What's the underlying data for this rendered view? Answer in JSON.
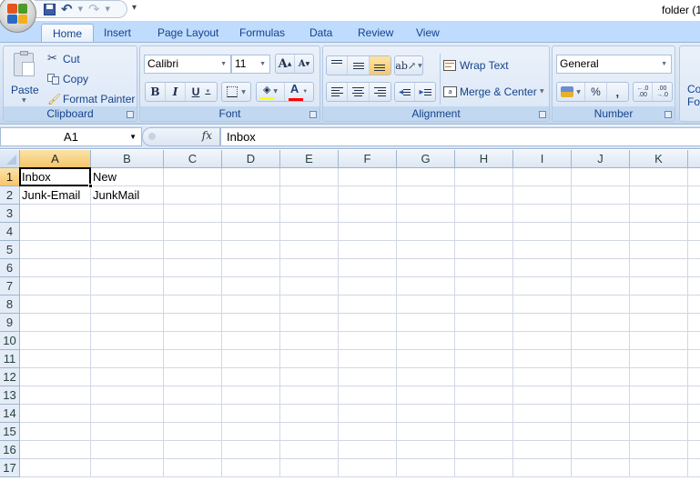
{
  "window": {
    "title": "folder (1",
    "office_button_icon": "office-logo-icon"
  },
  "quick_access": {
    "items": [
      {
        "name": "save",
        "icon": "save-icon",
        "glyph": "💾"
      },
      {
        "name": "undo",
        "icon": "undo-icon",
        "glyph": "↶"
      },
      {
        "name": "redo",
        "icon": "redo-icon",
        "glyph": "↷"
      }
    ],
    "customize_glyph": "⩡"
  },
  "tabs": [
    {
      "label": "Home",
      "active": true
    },
    {
      "label": "Insert"
    },
    {
      "label": "Page Layout"
    },
    {
      "label": "Formulas"
    },
    {
      "label": "Data"
    },
    {
      "label": "Review"
    },
    {
      "label": "View"
    }
  ],
  "ribbon": {
    "clipboard": {
      "label": "Clipboard",
      "paste": "Paste",
      "cut": "Cut",
      "copy": "Copy",
      "format_painter": "Format Painter"
    },
    "font": {
      "label": "Font",
      "font_name": "Calibri",
      "font_size": "11",
      "bold": "B",
      "italic": "I",
      "underline": "U",
      "grow": "A",
      "shrink": "A",
      "font_color": "A",
      "fill_color_hex": "#ffff00",
      "font_color_hex": "#ff0000"
    },
    "alignment": {
      "label": "Alignment",
      "wrap_text": "Wrap Text",
      "merge_center": "Merge & Center"
    },
    "number": {
      "label": "Number",
      "format": "General",
      "percent": "%",
      "comma": ",",
      "increase_decimal": ".00",
      "decrease_decimal": ".0"
    },
    "styles": {
      "conditional_line1": "Co",
      "conditional_line2": "For"
    }
  },
  "formula_bar": {
    "name_box": "A1",
    "fx": "fx",
    "value": "Inbox"
  },
  "sheet": {
    "columns": [
      "A",
      "B",
      "C",
      "D",
      "E",
      "F",
      "G",
      "H",
      "I",
      "J",
      "K"
    ],
    "rows": [
      "1",
      "2",
      "3",
      "4",
      "5",
      "6",
      "7",
      "8",
      "9",
      "10",
      "11",
      "12",
      "13",
      "14",
      "15",
      "16",
      "17"
    ],
    "cells": [
      [
        "Inbox",
        "New"
      ],
      [
        "Junk-Email",
        "JunkMail"
      ]
    ],
    "active_cell": "A1"
  }
}
